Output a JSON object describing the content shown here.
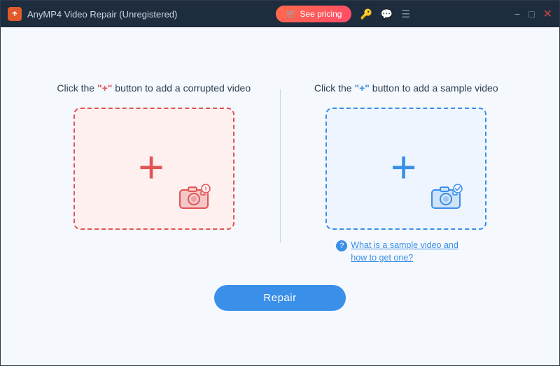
{
  "titlebar": {
    "app_name": "AnyMP4 Video Repair (Unregistered)",
    "app_icon_label": "A",
    "see_pricing_label": "See pricing",
    "icons": {
      "key": "🔑",
      "chat": "💬",
      "menu": "☰"
    },
    "controls": {
      "minimize": "−",
      "maximize": "□",
      "close": "✕"
    }
  },
  "left_panel": {
    "title_prefix": "Click the ",
    "title_plus": "\"+\"",
    "title_suffix": " button to add a corrupted video"
  },
  "right_panel": {
    "title_prefix": "Click the ",
    "title_plus": "\"+\"",
    "title_suffix": " button to add a sample video",
    "help_link": "What is a sample video and how to get one?"
  },
  "repair_button": {
    "label": "Repair"
  },
  "colors": {
    "red_accent": "#e05555",
    "blue_accent": "#3a8fe8",
    "bg": "#f5f8fc"
  }
}
